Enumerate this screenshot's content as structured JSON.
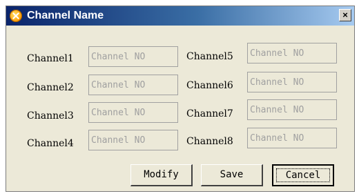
{
  "window": {
    "title": "Channel Name",
    "close_label": "×"
  },
  "icons": {
    "app": "app-icon",
    "close": "close-icon"
  },
  "channels": [
    {
      "label": "Channel1",
      "placeholder": "Channel NO"
    },
    {
      "label": "Channel2",
      "placeholder": "Channel NO"
    },
    {
      "label": "Channel3",
      "placeholder": "Channel NO"
    },
    {
      "label": "Channel4",
      "placeholder": "Channel NO"
    },
    {
      "label": "Channel5",
      "placeholder": "Channel NO"
    },
    {
      "label": "Channel6",
      "placeholder": "Channel NO"
    },
    {
      "label": "Channel7",
      "placeholder": "Channel NO"
    },
    {
      "label": "Channel8",
      "placeholder": "Channel NO"
    }
  ],
  "buttons": {
    "modify": "Modify",
    "save": "Save",
    "cancel": "Cancel"
  },
  "colors": {
    "dialog_bg": "#ece9d8",
    "titlebar_start": "#0a246a",
    "titlebar_end": "#a6caf0",
    "disabled_text": "#a0a0a0"
  }
}
